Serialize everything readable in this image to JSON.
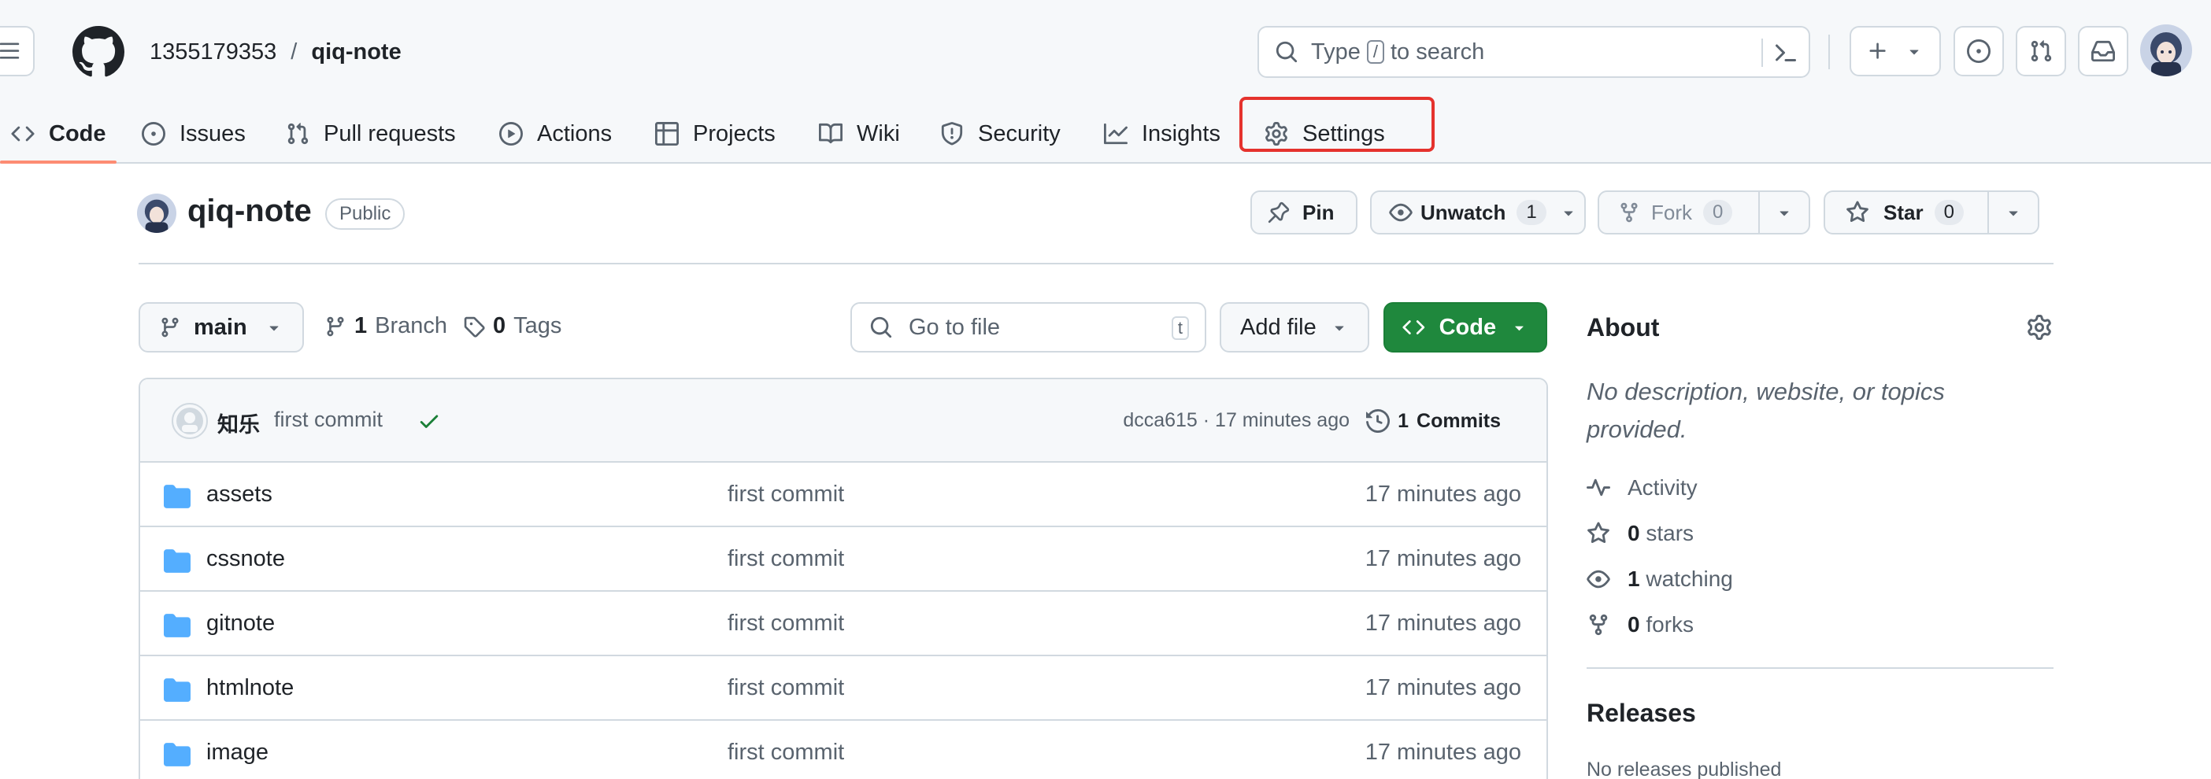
{
  "header": {
    "owner": "1355179353",
    "separator": "/",
    "repo": "qiq-note",
    "search_before": "Type",
    "search_key": "/",
    "search_after": "to search"
  },
  "tabs": [
    {
      "label": "Code",
      "icon": "code-icon",
      "selected": true
    },
    {
      "label": "Issues",
      "icon": "issue-opened-icon"
    },
    {
      "label": "Pull requests",
      "icon": "git-pull-request-icon"
    },
    {
      "label": "Actions",
      "icon": "play-icon"
    },
    {
      "label": "Projects",
      "icon": "table-icon"
    },
    {
      "label": "Wiki",
      "icon": "book-icon"
    },
    {
      "label": "Security",
      "icon": "shield-icon"
    },
    {
      "label": "Insights",
      "icon": "graph-icon"
    },
    {
      "label": "Settings",
      "icon": "gear-icon",
      "highlighted": true
    }
  ],
  "repo": {
    "name": "qiq-note",
    "visibility": "Public",
    "pin_label": "Pin",
    "unwatch_label": "Unwatch",
    "watch_count": "1",
    "fork_label": "Fork",
    "fork_count": "0",
    "star_label": "Star",
    "star_count": "0"
  },
  "toolbar": {
    "branch": "main",
    "branch_count": "1",
    "branch_label": "Branch",
    "tag_count": "0",
    "tag_label": "Tags",
    "goto_placeholder": "Go to file",
    "goto_key": "t",
    "add_file_label": "Add file",
    "code_label": "Code"
  },
  "commit": {
    "author": "知乐",
    "message": "first commit",
    "hash_time": "dcca615 · 17 minutes ago",
    "commits_count": "1",
    "commits_label": "Commits"
  },
  "files": [
    {
      "name": "assets",
      "message": "first commit",
      "age": "17 minutes ago"
    },
    {
      "name": "cssnote",
      "message": "first commit",
      "age": "17 minutes ago"
    },
    {
      "name": "gitnote",
      "message": "first commit",
      "age": "17 minutes ago"
    },
    {
      "name": "htmlnote",
      "message": "first commit",
      "age": "17 minutes ago"
    },
    {
      "name": "image",
      "message": "first commit",
      "age": "17 minutes ago"
    }
  ],
  "about": {
    "title": "About",
    "description": "No description, website, or topics provided.",
    "activity_label": "Activity",
    "stars_count": "0",
    "stars_label": "stars",
    "watching_count": "1",
    "watching_label": "watching",
    "forks_count": "0",
    "forks_label": "forks",
    "releases_title": "Releases",
    "releases_none": "No releases published"
  },
  "colors": {
    "accent_underline": "#fd8c73",
    "highlight_box": "#e5322d",
    "code_button": "#1f883d",
    "folder": "#54aeff"
  }
}
